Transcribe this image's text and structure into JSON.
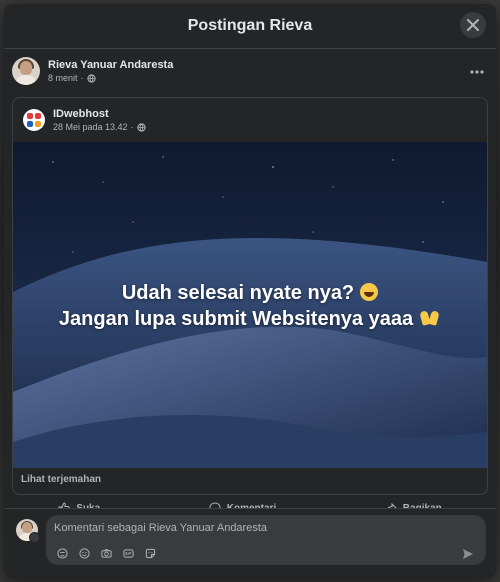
{
  "modal": {
    "title": "Postingan Rieva"
  },
  "post": {
    "author": "Rieva Yanuar Andaresta",
    "time": "8 menit",
    "privacy_icon": "globe-icon"
  },
  "shared": {
    "page_name": "IDwebhost",
    "time": "28 Mei pada 13.42",
    "caption_line1": "Udah selesai nyate nya?",
    "caption_line2": "Jangan lupa submit Websitenya yaaa",
    "see_translation": "Lihat terjemahan"
  },
  "actions": {
    "like_label": "Suka",
    "comment_label": "Komentari",
    "share_label": "Bagikan"
  },
  "composer": {
    "placeholder": "Komentari sebagai Rieva Yanuar Andaresta",
    "tools": [
      "avatar-sticker-icon",
      "emoji-icon",
      "camera-icon",
      "gif-icon",
      "sticker-icon"
    ],
    "send_icon": "send-icon"
  },
  "colors": {
    "modal_bg": "#242526",
    "text_primary": "#e4e6eb",
    "text_secondary": "#b0b3b8",
    "divider": "#3e4042"
  }
}
